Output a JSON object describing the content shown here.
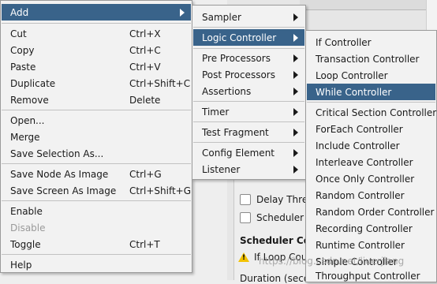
{
  "background": {
    "delay_thread_label": "Delay Threa",
    "scheduler_label": "Scheduler",
    "scheduler_config_heading": "Scheduler Con",
    "warning_text": "If Loop Cou",
    "duration_label": "Duration (seco",
    "watermark": "https://blog.csdn.net/liuerjiang"
  },
  "menu_main": {
    "items": [
      {
        "label": "Add",
        "shortcut": ""
      },
      {
        "label": "Cut",
        "shortcut": "Ctrl+X"
      },
      {
        "label": "Copy",
        "shortcut": "Ctrl+C"
      },
      {
        "label": "Paste",
        "shortcut": "Ctrl+V"
      },
      {
        "label": "Duplicate",
        "shortcut": "Ctrl+Shift+C"
      },
      {
        "label": "Remove",
        "shortcut": "Delete"
      },
      {
        "label": "Open...",
        "shortcut": ""
      },
      {
        "label": "Merge",
        "shortcut": ""
      },
      {
        "label": "Save Selection As...",
        "shortcut": ""
      },
      {
        "label": "Save Node As Image",
        "shortcut": "Ctrl+G"
      },
      {
        "label": "Save Screen As Image",
        "shortcut": "Ctrl+Shift+G"
      },
      {
        "label": "Enable",
        "shortcut": ""
      },
      {
        "label": "Disable",
        "shortcut": ""
      },
      {
        "label": "Toggle",
        "shortcut": "Ctrl+T"
      },
      {
        "label": "Help",
        "shortcut": ""
      }
    ]
  },
  "menu_add": {
    "items": [
      {
        "label": "Sampler"
      },
      {
        "label": "Logic Controller"
      },
      {
        "label": "Pre Processors"
      },
      {
        "label": "Post Processors"
      },
      {
        "label": "Assertions"
      },
      {
        "label": "Timer"
      },
      {
        "label": "Test Fragment"
      },
      {
        "label": "Config Element"
      },
      {
        "label": "Listener"
      }
    ]
  },
  "menu_logic": {
    "items": [
      {
        "label": "If Controller"
      },
      {
        "label": "Transaction Controller"
      },
      {
        "label": "Loop Controller"
      },
      {
        "label": "While Controller"
      },
      {
        "label": "Critical Section Controller"
      },
      {
        "label": "ForEach Controller"
      },
      {
        "label": "Include Controller"
      },
      {
        "label": "Interleave Controller"
      },
      {
        "label": "Once Only Controller"
      },
      {
        "label": "Random Controller"
      },
      {
        "label": "Random Order Controller"
      },
      {
        "label": "Recording Controller"
      },
      {
        "label": "Runtime Controller"
      },
      {
        "label": "Simple Controller"
      },
      {
        "label": "Throughput Controller"
      }
    ]
  },
  "colors": {
    "selection": "#39638a",
    "menu_bg": "#f2f2f2"
  }
}
